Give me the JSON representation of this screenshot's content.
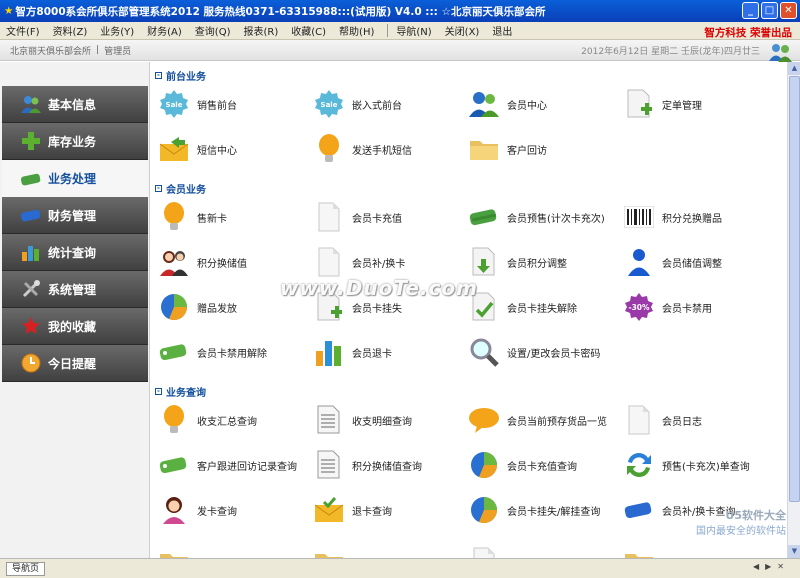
{
  "window": {
    "title": "智方8000系会所俱乐部管理系统2012  服务热线0371-63315988:::(试用版)  V4.0   :::  ☆北京丽天俱乐部会所",
    "brand": "智方科技  荣誉出品"
  },
  "menu": [
    "文件(F)",
    "资料(Z)",
    "业务(Y)",
    "财务(A)",
    "查询(Q)",
    "报表(R)",
    "收藏(C)",
    "帮助(H)",
    "导航(N)",
    "关闭(X)",
    "退出"
  ],
  "userbar": {
    "org": "北京丽天俱乐部会所",
    "role": "管理员",
    "date": "2012年6月12日  星期二  壬辰(龙年)四月廿三"
  },
  "sidebar": [
    {
      "label": "基本信息",
      "icon": "users-icon"
    },
    {
      "label": "库存业务",
      "icon": "plus-icon"
    },
    {
      "label": "业务处理",
      "icon": "card-icon",
      "active": true
    },
    {
      "label": "财务管理",
      "icon": "card-blue-icon"
    },
    {
      "label": "统计查询",
      "icon": "bar-chart-icon"
    },
    {
      "label": "系统管理",
      "icon": "tools-icon"
    },
    {
      "label": "我的收藏",
      "icon": "star-icon"
    },
    {
      "label": "今日提醒",
      "icon": "clock-icon"
    }
  ],
  "sections": [
    {
      "title": "前台业务",
      "items": [
        "销售前台",
        "嵌入式前台",
        "会员中心",
        "定单管理",
        "短信中心",
        "发送手机短信",
        "客户回访"
      ]
    },
    {
      "title": "会员业务",
      "items": [
        "售新卡",
        "会员卡充值",
        "会员预售(计次卡充次)",
        "积分兑换赠品",
        "积分换储值",
        "会员补/换卡",
        "会员积分调整",
        "会员储值调整",
        "赠品发放",
        "会员卡挂失",
        "会员卡挂失解除",
        "会员卡禁用",
        "会员卡禁用解除",
        "会员退卡",
        "设置/更改会员卡密码"
      ]
    },
    {
      "title": "业务查询",
      "items": [
        "收支汇总查询",
        "收支明细查询",
        "会员当前预存货品一览",
        "会员日志",
        "客户跟进回访记录查询",
        "积分换储值查询",
        "会员卡充值查询",
        "预售(卡充次)单查询",
        "发卡查询",
        "退卡查询",
        "会员卡挂失/解挂查询",
        "会员补/换卡查询"
      ]
    }
  ],
  "statusbar": {
    "tab": "导航页"
  },
  "watermark": {
    "main": "www.DuoTe.com",
    "line1": "U5软件大全",
    "line2": "国内最安全的软件站"
  },
  "colors": {
    "title_bar": "#0a4fc8",
    "section_head": "#14509e",
    "brand": "#dd0000"
  }
}
